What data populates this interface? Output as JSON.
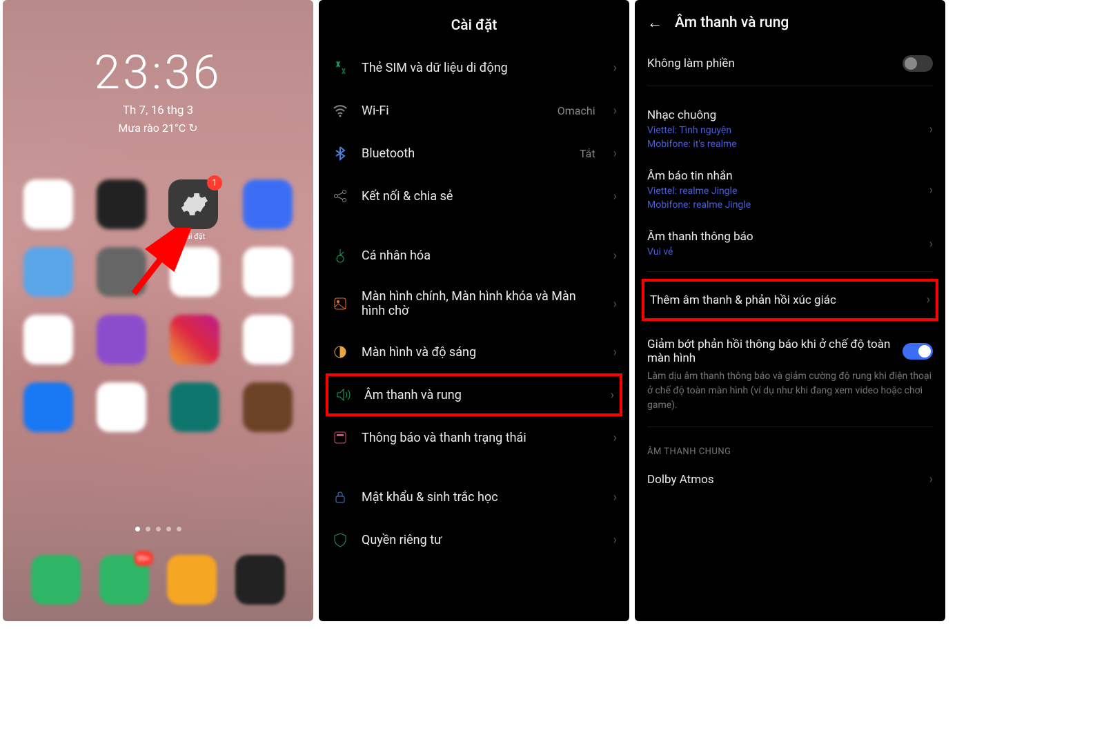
{
  "panel1": {
    "time": "23:36",
    "date": "Th 7, 16 thg 3",
    "weather": "Mưa rào 21°C",
    "settings_label": "Cài đặt",
    "settings_badge": "1",
    "msg_badge": "99+"
  },
  "panel2": {
    "title": "Cài đặt",
    "items": {
      "sim": "Thẻ SIM và dữ liệu di động",
      "wifi": "Wi-Fi",
      "wifi_val": "Omachi",
      "bt": "Bluetooth",
      "bt_val": "Tắt",
      "share": "Kết nối & chia sẻ",
      "personalize": "Cá nhân hóa",
      "screens": "Màn hình chính, Màn hình khóa và Màn hình chờ",
      "display": "Màn hình và độ sáng",
      "sound": "Âm thanh và rung",
      "notif": "Thông báo và thanh trạng thái",
      "security": "Mật khẩu & sinh trắc học",
      "privacy": "Quyền riêng tư"
    }
  },
  "panel3": {
    "title": "Âm thanh và rung",
    "dnd": "Không làm phiền",
    "ringtone": {
      "t": "Nhạc chuông",
      "s1": "Viettel: Tình nguyện",
      "s2": "Mobifone: it's realme"
    },
    "msgtone": {
      "t": "Âm báo tin nhắn",
      "s1": "Viettel: realme Jingle",
      "s2": "Mobifone: realme Jingle"
    },
    "notiftone": {
      "t": "Âm thanh thông báo",
      "s1": "Vui vẻ"
    },
    "more": "Thêm âm thanh & phản hồi xúc giác",
    "reduce": {
      "t": "Giảm bớt phản hồi thông báo khi ở chế độ toàn màn hình",
      "d": "Làm dịu âm thanh thông báo và giảm cường độ rung khi điện thoại ở chế độ toàn màn hình (ví dụ như khi đang xem video hoặc chơi game)."
    },
    "section": "ÂM THANH CHUNG",
    "dolby": "Dolby Atmos"
  }
}
